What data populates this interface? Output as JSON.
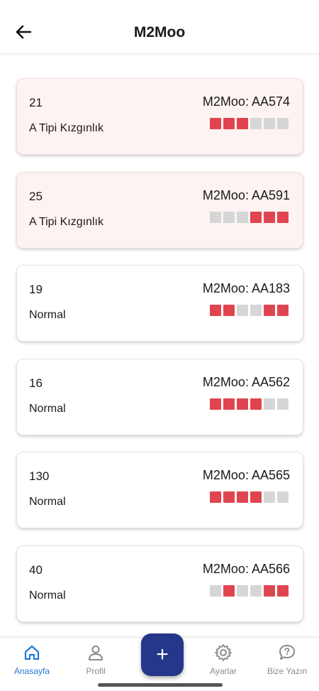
{
  "header": {
    "title": "M2Moo",
    "back_icon": "arrow-left-icon"
  },
  "colors": {
    "block_on": "#e0454f",
    "block_off": "#d6d6d6",
    "alert_bg": "#fdf3f2",
    "fab_bg": "#25378a",
    "active_nav": "#1f7ad6"
  },
  "cards": [
    {
      "value": "21",
      "device": "M2Moo: AA574",
      "status": "A Tipi Kızgınlık",
      "alert": true,
      "blocks": [
        1,
        1,
        1,
        0,
        0,
        0
      ]
    },
    {
      "value": "25",
      "device": "M2Moo: AA591",
      "status": "A Tipi Kızgınlık",
      "alert": true,
      "blocks": [
        0,
        0,
        0,
        1,
        1,
        1
      ]
    },
    {
      "value": "19",
      "device": "M2Moo: AA183",
      "status": "Normal",
      "alert": false,
      "blocks": [
        1,
        1,
        0,
        0,
        1,
        1
      ]
    },
    {
      "value": "16",
      "device": "M2Moo: AA562",
      "status": "Normal",
      "alert": false,
      "blocks": [
        1,
        1,
        1,
        1,
        0,
        0
      ]
    },
    {
      "value": "130",
      "device": "M2Moo: AA565",
      "status": "Normal",
      "alert": false,
      "blocks": [
        1,
        1,
        1,
        1,
        0,
        0
      ]
    },
    {
      "value": "40",
      "device": "M2Moo: AA566",
      "status": "Normal",
      "alert": false,
      "blocks": [
        0,
        1,
        0,
        0,
        1,
        1
      ]
    }
  ],
  "nav": {
    "items": [
      {
        "label": "Anasayfa",
        "icon": "home-icon",
        "active": true
      },
      {
        "label": "Profil",
        "icon": "user-icon",
        "active": false
      },
      {
        "label": "Ayarlar",
        "icon": "gear-icon",
        "active": false
      },
      {
        "label": "Bize Yazın",
        "icon": "help-chat-icon",
        "active": false
      }
    ],
    "fab_label": "+"
  }
}
